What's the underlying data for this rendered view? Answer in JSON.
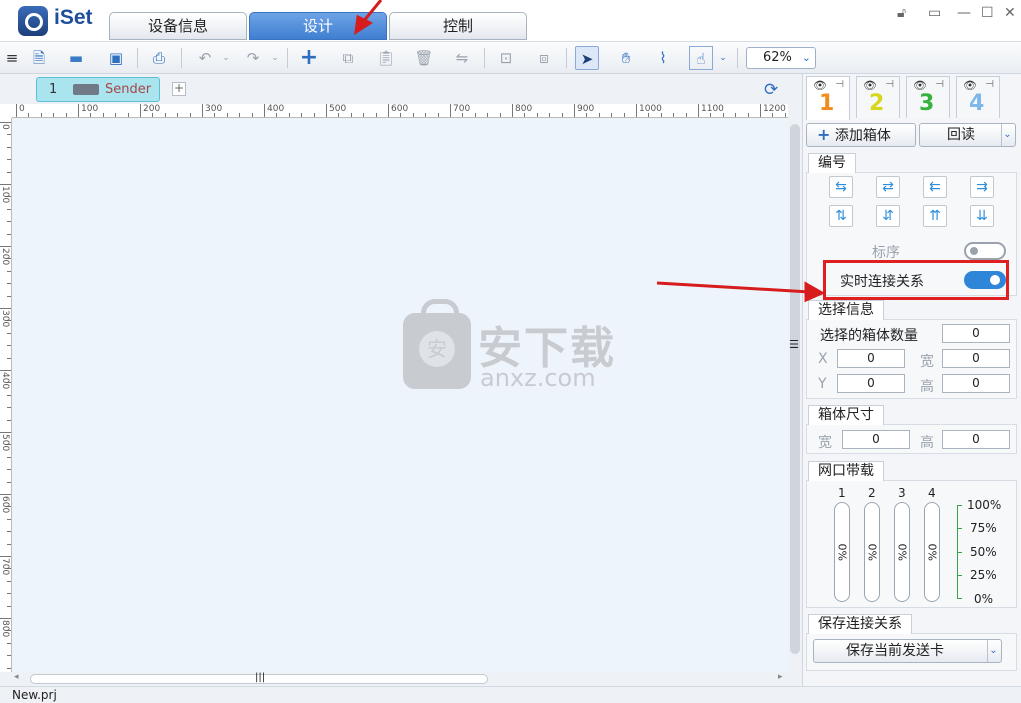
{
  "app": {
    "name": "iSet"
  },
  "tabs": [
    {
      "label": "设备信息",
      "active": false
    },
    {
      "label": "设计",
      "active": true
    },
    {
      "label": "控制",
      "active": false
    }
  ],
  "toolbar": {
    "zoom": "62%"
  },
  "canvas": {
    "sender_tab": {
      "index": "1",
      "name": "Sender 1"
    },
    "add_tab": "+",
    "ruler_top": [
      "0",
      "100",
      "200",
      "300",
      "400",
      "500",
      "600",
      "700",
      "800",
      "900",
      "1000",
      "1100",
      "1200"
    ],
    "ruler_left": [
      "0",
      "100",
      "200",
      "300",
      "400",
      "500",
      "600",
      "700",
      "800"
    ],
    "watermark": {
      "cn": "安下载",
      "en": "anxz.com"
    }
  },
  "panel": {
    "tabs": [
      {
        "label": "1",
        "color": "#f28c1c"
      },
      {
        "label": "2",
        "color": "#d6d61a"
      },
      {
        "label": "3",
        "color": "#36b33f"
      },
      {
        "label": "4",
        "color": "#7eb8e8"
      }
    ],
    "add_box": "添加箱体",
    "readback": "回读",
    "numbering": {
      "title": "编号",
      "label_order": "标序",
      "realtime_link": "实时连接关系",
      "label_order_on": false,
      "realtime_link_on": true
    },
    "selection": {
      "title": "选择信息",
      "count_label": "选择的箱体数量",
      "count": "0",
      "x_label": "X",
      "x": "0",
      "w_label": "宽",
      "w": "0",
      "y_label": "Y",
      "y": "0",
      "h_label": "高",
      "h": "0"
    },
    "box_size": {
      "title": "箱体尺寸",
      "w_label": "宽",
      "w": "0",
      "h_label": "高",
      "h": "0"
    },
    "bandwidth": {
      "title": "网口带载",
      "ports": [
        {
          "label": "1",
          "value": "0%",
          "fill": 0
        },
        {
          "label": "2",
          "value": "0%",
          "fill": 0
        },
        {
          "label": "3",
          "value": "0%",
          "fill": 0
        },
        {
          "label": "4",
          "value": "0%",
          "fill": 0
        }
      ],
      "scale": [
        "100%",
        "75%",
        "50%",
        "25%",
        "0%"
      ]
    },
    "save": {
      "title": "保存连接关系",
      "button": "保存当前发送卡"
    }
  },
  "status": {
    "file": "New.prj"
  }
}
